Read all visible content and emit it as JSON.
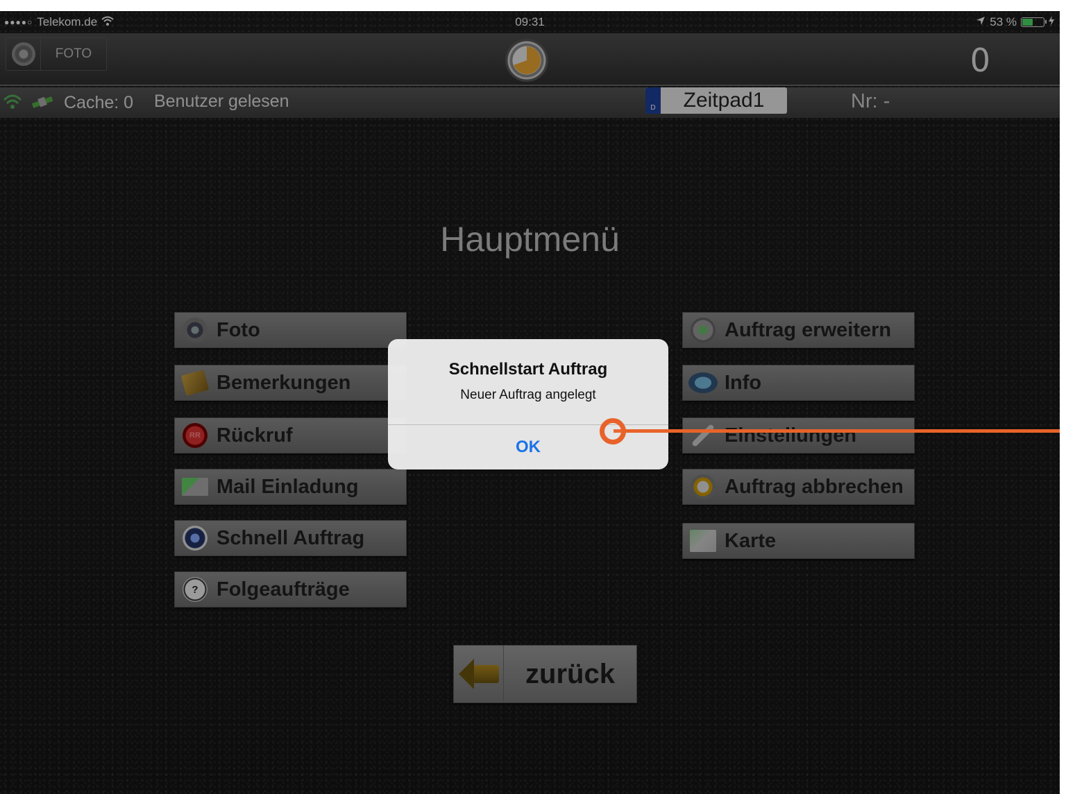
{
  "status_bar": {
    "signal": "●●●●○",
    "carrier": "Telekom.de",
    "wifi_icon": "wifi-icon",
    "time": "09:31",
    "location_icon": "location-arrow-icon",
    "battery_percent_text": "53 %",
    "battery_level": 0.53,
    "charging_icon": "bolt-icon"
  },
  "top_bar": {
    "foto_label": "FOTO",
    "counter": "0"
  },
  "info_bar": {
    "cache": "Cache: 0",
    "user_status": "Benutzer gelesen",
    "device_name": "Zeitpad1",
    "plate_letter": "D",
    "nr": "Nr: -"
  },
  "main": {
    "title": "Hauptmenü",
    "left_buttons": [
      {
        "label": "Foto",
        "icon": "camera-icon"
      },
      {
        "label": "Bemerkungen",
        "icon": "notes-icon"
      },
      {
        "label": "Rückruf",
        "icon": "callback-icon"
      },
      {
        "label": "Mail Einladung",
        "icon": "mail-icon"
      },
      {
        "label": "Schnell Auftrag",
        "icon": "quick-order-icon"
      },
      {
        "label": "Folgeaufträge",
        "icon": "follow-up-icon"
      }
    ],
    "right_buttons": [
      {
        "label": "Auftrag erweitern",
        "icon": "extend-order-icon"
      },
      {
        "label": "Info",
        "icon": "info-icon"
      },
      {
        "label": "Einstellungen",
        "icon": "wrench-icon"
      },
      {
        "label": "Auftrag abbrechen",
        "icon": "abort-order-icon"
      },
      {
        "label": "Karte",
        "icon": "map-icon"
      }
    ],
    "back_label": "zurück"
  },
  "alert": {
    "title": "Schnellstart Auftrag",
    "message": "Neuer Auftrag angelegt",
    "ok_label": "OK"
  },
  "colors": {
    "accent_ok": "#1a73e8",
    "pointer": "#e8632a",
    "battery": "#4cd964"
  }
}
